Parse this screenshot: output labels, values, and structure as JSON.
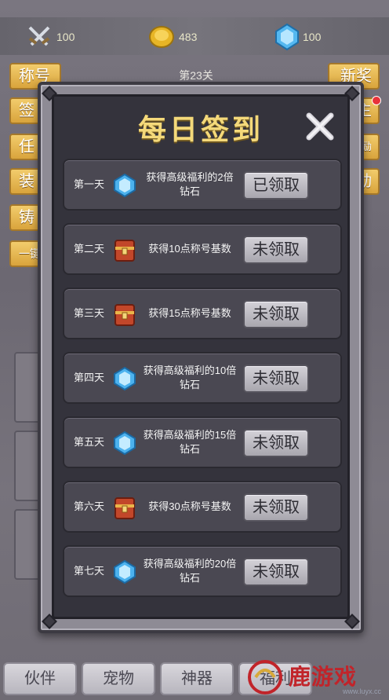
{
  "resources": {
    "swords": "100",
    "gold": "483",
    "gems": "100"
  },
  "level_label": "第23关",
  "side_buttons": {
    "left": [
      "称号",
      "签",
      "任",
      "装",
      "铸",
      "一键"
    ],
    "right": [
      "新奖",
      "主",
      "鉴励",
      "动"
    ]
  },
  "bottom_tabs": [
    "伙伴",
    "宠物",
    "神器",
    "福利"
  ],
  "watermark": {
    "text": "鹿游戏",
    "url": "www.luyx.cc"
  },
  "modal": {
    "title": "每日签到",
    "days": [
      {
        "day": "第一天",
        "icon": "diamond-icon",
        "reward_line1": "获得高级福利的2倍",
        "reward_line2": "钻石",
        "button": "已领取"
      },
      {
        "day": "第二天",
        "icon": "chest-icon",
        "reward_line1": "获得10点称号基数",
        "reward_line2": "",
        "button": "未领取"
      },
      {
        "day": "第三天",
        "icon": "chest-icon",
        "reward_line1": "获得15点称号基数",
        "reward_line2": "",
        "button": "未领取"
      },
      {
        "day": "第四天",
        "icon": "diamond-icon",
        "reward_line1": "获得高级福利的10倍",
        "reward_line2": "钻石",
        "button": "未领取"
      },
      {
        "day": "第五天",
        "icon": "diamond-icon",
        "reward_line1": "获得高级福利的15倍",
        "reward_line2": "钻石",
        "button": "未领取"
      },
      {
        "day": "第六天",
        "icon": "chest-icon",
        "reward_line1": "获得30点称号基数",
        "reward_line2": "",
        "button": "未领取"
      },
      {
        "day": "第七天",
        "icon": "diamond-icon",
        "reward_line1": "获得高级福利的20倍",
        "reward_line2": "钻石",
        "button": "未领取"
      }
    ]
  },
  "colors": {
    "title": "#f4d97a",
    "panel": "#34333c",
    "row": "#4a4852",
    "gold_button": "#e9bb55"
  }
}
